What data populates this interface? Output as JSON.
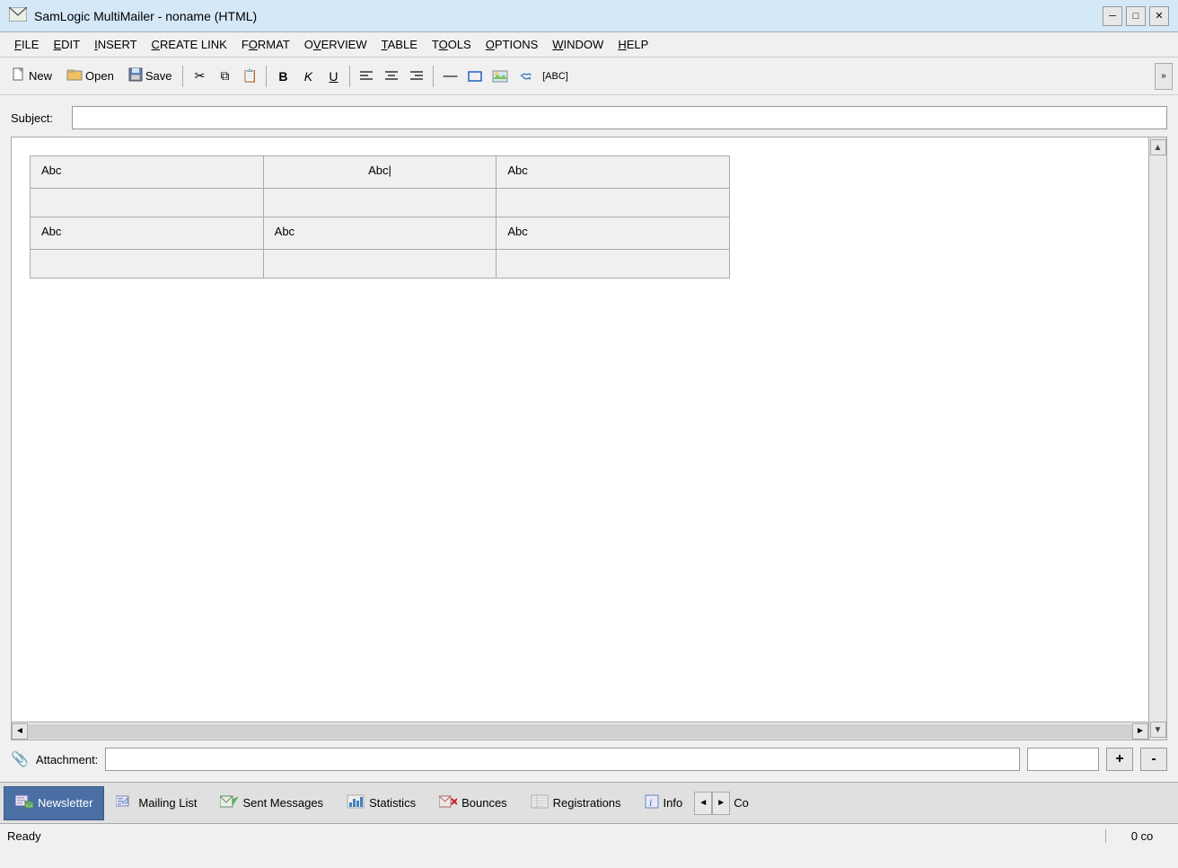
{
  "titlebar": {
    "title": "SamLogic MultiMailer - noname  (HTML)",
    "icon": "✉",
    "minimize": "─",
    "maximize": "□",
    "close": "✕"
  },
  "menubar": {
    "items": [
      {
        "label": "FILE",
        "underline": "F"
      },
      {
        "label": "EDIT",
        "underline": "E"
      },
      {
        "label": "INSERT",
        "underline": "I"
      },
      {
        "label": "CREATE LINK",
        "underline": "C"
      },
      {
        "label": "FORMAT",
        "underline": "O"
      },
      {
        "label": "OVERVIEW",
        "underline": "V"
      },
      {
        "label": "TABLE",
        "underline": "T"
      },
      {
        "label": "TOOLS",
        "underline": "T"
      },
      {
        "label": "OPTIONS",
        "underline": "O"
      },
      {
        "label": "WINDOW",
        "underline": "W"
      },
      {
        "label": "HELP",
        "underline": "H"
      }
    ]
  },
  "toolbar": {
    "new_label": "New",
    "open_label": "Open",
    "save_label": "Save",
    "bold_label": "B",
    "italic_label": "K",
    "underline_label": "U",
    "align_left": "≡",
    "align_center": "≡",
    "align_right": "≡",
    "hrule": "—",
    "rectangle": "□",
    "image": "🖼",
    "link": "🔗",
    "spell": "[ABC]"
  },
  "subject": {
    "label": "Subject:",
    "value": "",
    "placeholder": ""
  },
  "editor": {
    "table": {
      "rows": [
        [
          "Abc",
          "Abc",
          "Abc"
        ],
        [
          "",
          "",
          ""
        ],
        [
          "Abc",
          "Abc",
          "Abc"
        ],
        [
          "",
          "",
          ""
        ]
      ]
    }
  },
  "attachment": {
    "label": "Attachment:",
    "value": "",
    "field2_value": "",
    "add_btn": "+",
    "remove_btn": "-",
    "icon": "📎"
  },
  "tabs": [
    {
      "label": "Newsletter",
      "active": true,
      "icon": "newsletter"
    },
    {
      "label": "Mailing List",
      "active": false,
      "icon": "mailinglist"
    },
    {
      "label": "Sent Messages",
      "active": false,
      "icon": "sentmessages"
    },
    {
      "label": "Statistics",
      "active": false,
      "icon": "statistics"
    },
    {
      "label": "Bounces",
      "active": false,
      "icon": "bounces"
    },
    {
      "label": "Registrations",
      "active": false,
      "icon": "registrations"
    },
    {
      "label": "Info",
      "active": false,
      "icon": "info"
    }
  ],
  "statusbar": {
    "left": "Ready",
    "right": "0 co"
  }
}
